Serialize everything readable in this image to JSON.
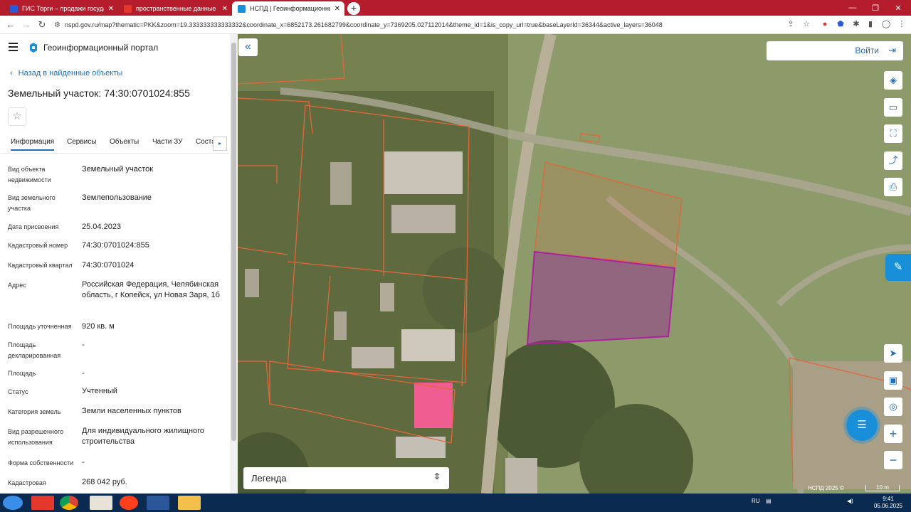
{
  "browser": {
    "tabs": [
      {
        "title": "ГИС Торги – продажи государст",
        "favicon_color": "#2a5bd7"
      },
      {
        "title": "пространственные данные рос",
        "favicon_color": "#e5382d"
      },
      {
        "title": "НСПД | Геоинформационный п",
        "favicon_color": "#1a8fd9",
        "active": true
      }
    ],
    "new_tab_icon": "plus-icon",
    "url": "nspd.gov.ru/map?thematic=PKK&zoom=19.333333333333332&coordinate_x=6852173.261682799&coordinate_y=7369205.027112014&theme_id=1&is_copy_url=true&baseLayerId=36344&active_layers=36048"
  },
  "portal": {
    "title": "Геоинформационный портал"
  },
  "panel": {
    "back_link": "Назад в найденные объекты",
    "page_title": "Земельный участок: 74:30:0701024:855",
    "tabs": [
      "Информация",
      "Сервисы",
      "Объекты",
      "Части ЗУ",
      "Состав"
    ],
    "active_tab": "Информация",
    "fields": [
      {
        "label": "Вид объекта недвижимости",
        "value": "Земельный участок"
      },
      {
        "label": "Вид земельного участка",
        "value": "Землепользование"
      },
      {
        "label": "Дата присвоения",
        "value": "25.04.2023"
      },
      {
        "label": "Кадастровый номер",
        "value": "74:30:0701024:855"
      },
      {
        "label": "Кадастровый квартал",
        "value": "74:30:0701024"
      },
      {
        "label": "Адрес",
        "value": "Российская Федерация, Челябинская область, г Копейск, ул Новая Заря, 1б"
      },
      {
        "label": "Площадь уточненная",
        "value": "920 кв. м"
      },
      {
        "label": "Площадь декларированная",
        "value": "-"
      },
      {
        "label": "Площадь",
        "value": "-"
      },
      {
        "label": "Статус",
        "value": "Учтенный"
      },
      {
        "label": "Категория земель",
        "value": "Земли населенных пунктов"
      },
      {
        "label": "Вид разрешенного использования",
        "value": "Для индивидуального жилищного строительства"
      },
      {
        "label": "Форма собственности",
        "value": "-"
      },
      {
        "label": "Кадастровая",
        "value": "268 042 руб."
      }
    ]
  },
  "map": {
    "login_label": "Войти",
    "legend_label": "Легенда",
    "copyright": "НСПД 2025 ©",
    "scale_label": "10 m",
    "colors": {
      "parcel_outline": "#e2673c",
      "selected_parcel": "#b01fa0",
      "highlight_building": "#ff5c9a"
    }
  },
  "taskbar": {
    "language": "RU",
    "time": "9:41",
    "date": "05.06.2025"
  }
}
